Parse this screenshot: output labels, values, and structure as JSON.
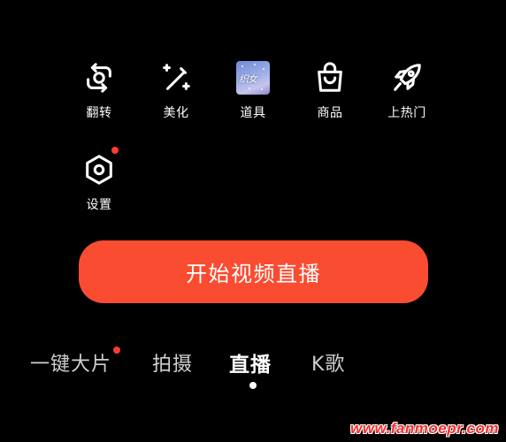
{
  "tools": [
    {
      "label": "翻转",
      "icon": "flip-camera-icon"
    },
    {
      "label": "美化",
      "icon": "magic-wand-icon"
    },
    {
      "label": "道具",
      "icon": "props-thumbnail-icon",
      "thumbnail_text": "织女"
    },
    {
      "label": "商品",
      "icon": "shopping-bag-icon"
    },
    {
      "label": "上热门",
      "icon": "rocket-icon"
    },
    {
      "label": "设置",
      "icon": "settings-hex-icon",
      "has_badge": true
    }
  ],
  "primary_action": {
    "label": "开始视频直播",
    "color": "#fa4c30"
  },
  "mode_tabs": [
    {
      "label": "一键大片",
      "has_badge": true,
      "active": false
    },
    {
      "label": "拍摄",
      "active": false
    },
    {
      "label": "直播",
      "active": true
    },
    {
      "label": "K歌",
      "active": false
    }
  ],
  "watermark": "www.fanmoepr.com",
  "colors": {
    "background": "#000000",
    "accent": "#fa4c30",
    "badge": "#fe3b35"
  }
}
